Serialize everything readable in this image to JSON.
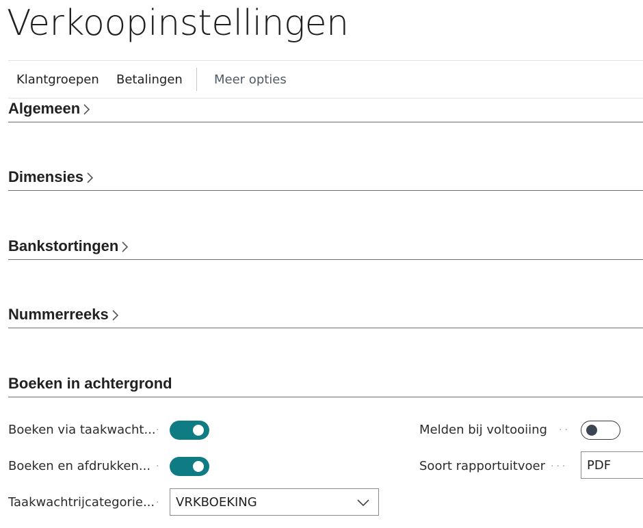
{
  "page": {
    "title": "Verkoopinstellingen"
  },
  "actions": {
    "klantgroepen": "Klantgroepen",
    "betalingen": "Betalingen",
    "meer_opties": "Meer opties"
  },
  "sections": {
    "algemeen": "Algemeen",
    "dimensies": "Dimensies",
    "bankstortingen": "Bankstortingen",
    "nummerreeks": "Nummerreeks",
    "boeken": "Boeken in achtergrond"
  },
  "fields": {
    "boeken_via": {
      "label": "Boeken via taakwacht...",
      "value": true
    },
    "boeken_afdrukken": {
      "label": "Boeken en afdrukken...",
      "value": true
    },
    "taakwachtrij": {
      "label": "Taakwachtrijcategorie...",
      "value": "VRKBOEKING"
    },
    "melden": {
      "label": "Melden bij voltooiing",
      "value": false
    },
    "soort_rapport": {
      "label": "Soort rapportuitvoer",
      "value": "PDF"
    }
  },
  "colors": {
    "toggle_on": "#0f7b83",
    "section_rule": "#6e6e6e"
  },
  "icons": {
    "section_expand": "chevron-right-icon",
    "dropdown": "chevron-down-icon"
  }
}
